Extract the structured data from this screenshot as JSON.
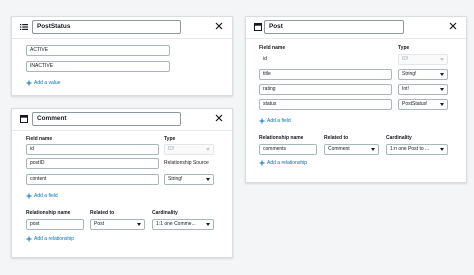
{
  "enum_card": {
    "title": "PostStatus",
    "values": [
      "ACTIVE",
      "INACTIVE"
    ],
    "add_label": "Add a value"
  },
  "comment_card": {
    "title": "Comment",
    "field_name_header": "Field name",
    "type_header": "Type",
    "fields": [
      {
        "name": "id",
        "type": "ID!"
      },
      {
        "name": "postID",
        "type": "Relationship Source"
      },
      {
        "name": "content",
        "type": "String!"
      }
    ],
    "add_field_label": "Add a field",
    "rel_name_header": "Relationship name",
    "related_to_header": "Related to",
    "cardinality_header": "Cardinality",
    "relationships": [
      {
        "name": "post",
        "related_to": "Post",
        "cardinality": "1:1 one Comme..."
      }
    ],
    "add_relationship_label": "Add a relationship"
  },
  "post_card": {
    "title": "Post",
    "field_name_header": "Field name",
    "type_header": "Type",
    "fields": [
      {
        "name": "id",
        "type": "ID!"
      },
      {
        "name": "title",
        "type": "String!"
      },
      {
        "name": "rating",
        "type": "Int!"
      },
      {
        "name": "status",
        "type": "PostStatus!"
      }
    ],
    "add_field_label": "Add a field",
    "rel_name_header": "Relationship name",
    "related_to_header": "Related to",
    "cardinality_header": "Cardinality",
    "relationships": [
      {
        "name": "comments",
        "related_to": "Comment",
        "cardinality": "1:n one Post to ..."
      }
    ],
    "add_relationship_label": "Add a relationship"
  }
}
